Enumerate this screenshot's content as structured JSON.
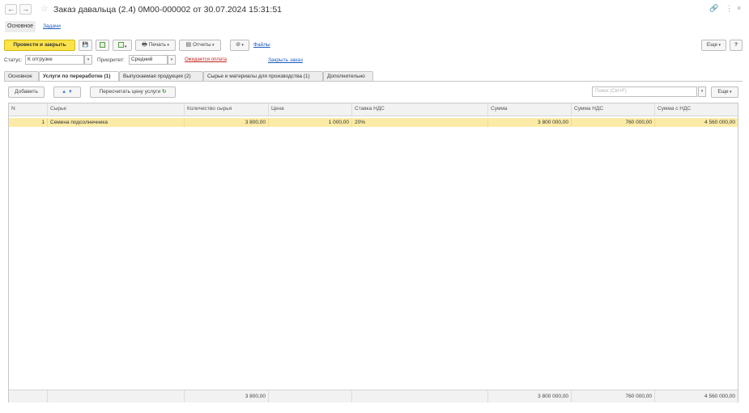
{
  "window": {
    "back_icon": "←",
    "forward_icon": "→",
    "star_icon": "☆",
    "title": "Заказ давальца (2.4) 0М00-000002 от 30.07.2024 15:31:51",
    "link_icon": "🔗",
    "more_icon": "⋮",
    "close_icon": "×"
  },
  "form_tabs": {
    "main": "Основное",
    "tasks": "Задачи"
  },
  "commands": {
    "post_and_close": "Провести и закрыть",
    "save_icon": "💾",
    "print": "Печать",
    "reports": "Отчеты",
    "files": "Файлы",
    "more": "Еще",
    "help": "?"
  },
  "status_row": {
    "status_label": "Статус:",
    "status_value": "К отгрузке",
    "priority_label": "Приоритет:",
    "priority_value": "Средний",
    "payment_state": "Ожидается оплата",
    "close_order": "Закрыть заказ"
  },
  "tabs": [
    {
      "label": "Основное"
    },
    {
      "label": "Услуги по переработке (1)"
    },
    {
      "label": "Выпускаемая продукция (2)"
    },
    {
      "label": "Сырье и материалы для производства (1)"
    },
    {
      "label": "Дополнительно"
    }
  ],
  "table_toolbar": {
    "add": "Добавить",
    "up_icon": "▲",
    "down_icon": "▼",
    "recalc": "Пересчитать цену услуги",
    "recalc_icon": "↻",
    "search_placeholder": "Поиск (Ctrl+F)",
    "more": "Еще"
  },
  "table": {
    "columns": [
      "N",
      "Сырье",
      "Количество сырья",
      "Цена",
      "Ставка НДС",
      "Сумма",
      "Сумма НДС",
      "Сумма с НДС"
    ],
    "rows": [
      {
        "n": "1",
        "material": "Семена подсолнечника",
        "qty": "3 800,00",
        "price": "1 000,00",
        "vat_rate": "20%",
        "sum": "3 800 000,00",
        "vat_sum": "760 000,00",
        "total": "4 560 000,00"
      }
    ],
    "totals": {
      "qty": "3 800,00",
      "sum": "3 800 000,00",
      "vat_sum": "760 000,00",
      "total": "4 560 000,00"
    }
  },
  "colors": {
    "accent_button": "#fce34c",
    "selected_row": "#fbeba6",
    "link": "#1b5bbf",
    "warning_link": "#c3261f"
  }
}
